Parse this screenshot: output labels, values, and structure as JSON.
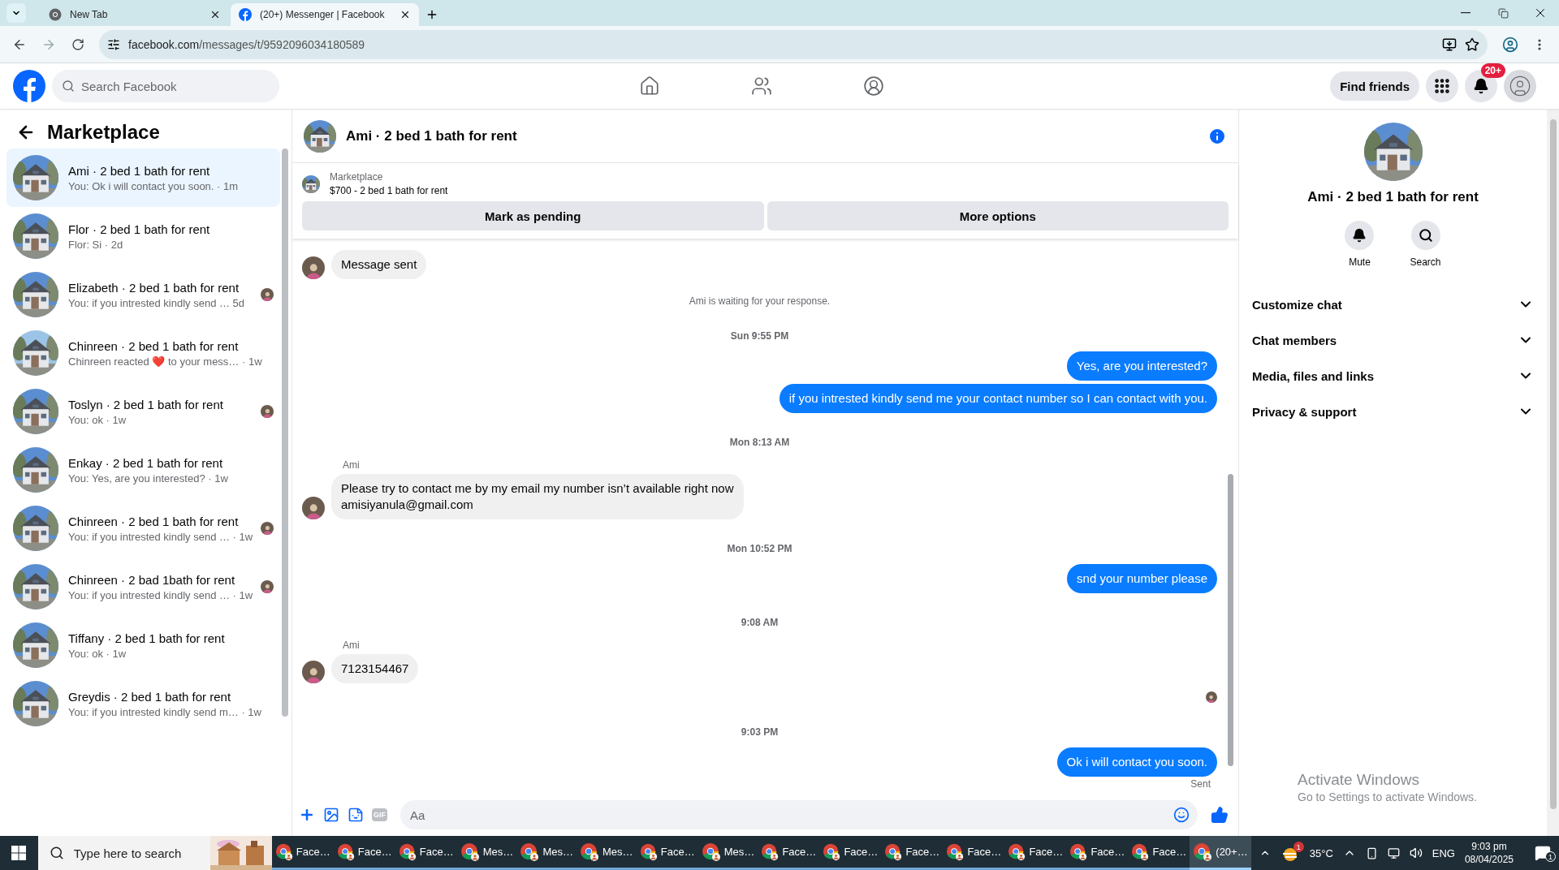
{
  "browser": {
    "tabs": [
      {
        "title": "New Tab",
        "kind": "newtab",
        "selected": false
      },
      {
        "title": "(20+) Messenger | Facebook",
        "kind": "facebook",
        "selected": true
      }
    ],
    "url": {
      "host": "facebook.com",
      "path": "/messages/t/9592096034180589"
    }
  },
  "header": {
    "search_placeholder": "Search Facebook",
    "nav": [
      {
        "kind": "home"
      },
      {
        "kind": "friends"
      },
      {
        "kind": "groups"
      }
    ],
    "find_friends": "Find friends",
    "notifications_badge": "20+"
  },
  "sidebar": {
    "title": "Marketplace",
    "conversations": [
      {
        "title": "Ami · 2 bed 1 bath for rent",
        "preview": "You: Ok i will contact you soon. · 1m",
        "selected": true,
        "seen": false
      },
      {
        "title": "Flor · 2 bed 1 bath for rent",
        "preview": "Flor: Si · 2d",
        "selected": false,
        "seen": false
      },
      {
        "title": "Elizabeth · 2 bed 1 bath for rent",
        "preview": "You: if you intrested kindly send … 5d",
        "selected": false,
        "seen": true
      },
      {
        "title": "Chinreen · 2 bed 1 bath for rent",
        "preview": "Chinreen reacted ❤️ to your mess… · 1w",
        "selected": false,
        "seen": false
      },
      {
        "title": "Toslyn · 2 bed 1 bath for rent",
        "preview": "You: ok · 1w",
        "selected": false,
        "seen": true
      },
      {
        "title": "Enkay · 2 bed 1 bath for rent",
        "preview": "You: Yes, are you interested? · 1w",
        "selected": false,
        "seen": false
      },
      {
        "title": "Chinreen · 2 bed 1 bath for rent",
        "preview": "You: if you intrested kindly send … · 1w",
        "selected": false,
        "seen": true
      },
      {
        "title": "Chinreen · 2 bad 1bath for rent",
        "preview": "You: if you intrested kindly send … · 1w",
        "selected": false,
        "seen": true
      },
      {
        "title": "Tiffany · 2 bed 1 bath for rent",
        "preview": "You: ok · 1w",
        "selected": false,
        "seen": false
      },
      {
        "title": "Greydis · 2 bed 1 bath for rent",
        "preview": "You: if you intrested kindly send m… · 1w",
        "selected": false,
        "seen": false
      }
    ]
  },
  "chat": {
    "title": "Ami · 2 bed 1 bath for rent",
    "listing": {
      "label": "Marketplace",
      "summary": "$700 - 2 bed 1 bath for rent"
    },
    "actions": [
      "Mark as pending",
      "More options"
    ],
    "messages": [
      {
        "kind": "incoming",
        "text": "Message sent"
      },
      {
        "kind": "notice",
        "text": "Ami is waiting for your response."
      },
      {
        "kind": "time",
        "text": "Sun 9:55 PM"
      },
      {
        "kind": "outgoing",
        "text": "Yes, are you interested?"
      },
      {
        "kind": "outgoing",
        "text": "if you intrested kindly send me your contact number so I can contact with you."
      },
      {
        "kind": "time",
        "text": "Mon 8:13 AM"
      },
      {
        "kind": "incoming",
        "sender": "Ami",
        "text": "Please try to contact me by my email my number isn’t available right now\namisiyanula@gmail.com"
      },
      {
        "kind": "time",
        "text": "Mon 10:52 PM"
      },
      {
        "kind": "outgoing",
        "text": "snd your number please"
      },
      {
        "kind": "time",
        "text": "9:08 AM"
      },
      {
        "kind": "incoming",
        "sender": "Ami",
        "text": "7123154467"
      },
      {
        "kind": "seen"
      },
      {
        "kind": "time",
        "text": "9:03 PM"
      },
      {
        "kind": "outgoing",
        "text": "Ok i will contact you soon."
      },
      {
        "kind": "status",
        "text": "Sent"
      }
    ],
    "composer": {
      "placeholder": "Aa",
      "gif": "GIF"
    }
  },
  "details": {
    "title": "Ami · 2 bed 1 bath for rent",
    "actions": [
      {
        "kind": "mute",
        "label": "Mute"
      },
      {
        "kind": "search",
        "label": "Search"
      }
    ],
    "sections": [
      {
        "label": "Customize chat",
        "expanded": false
      },
      {
        "label": "Chat members",
        "expanded": false
      },
      {
        "label": "Media, files and links",
        "expanded": false
      },
      {
        "label": "Privacy & support",
        "expanded": false
      }
    ]
  },
  "activation": {
    "title": "Activate Windows",
    "subtitle": "Go to Settings to activate Windows."
  },
  "taskbar": {
    "search_placeholder": "Type here to search",
    "apps": [
      {
        "label": "Face…",
        "selected": false
      },
      {
        "label": "Face…",
        "selected": false
      },
      {
        "label": "Face…",
        "selected": false
      },
      {
        "label": "Mes…",
        "selected": false
      },
      {
        "label": "Mes…",
        "selected": false
      },
      {
        "label": "Mes…",
        "selected": false
      },
      {
        "label": "Face…",
        "selected": false
      },
      {
        "label": "Mes…",
        "selected": false
      },
      {
        "label": "Face…",
        "selected": false
      },
      {
        "label": "Face…",
        "selected": false
      },
      {
        "label": "Face…",
        "selected": false
      },
      {
        "label": "Face…",
        "selected": false
      },
      {
        "label": "Face…",
        "selected": false
      },
      {
        "label": "Face…",
        "selected": false
      },
      {
        "label": "Face…",
        "selected": false
      },
      {
        "label": "(20+…",
        "selected": true
      }
    ],
    "weather_badge": "1",
    "temperature": "35°C",
    "language": "ENG",
    "time": "9:03 pm",
    "date": "08/04/2025",
    "notification_badge": "1"
  }
}
